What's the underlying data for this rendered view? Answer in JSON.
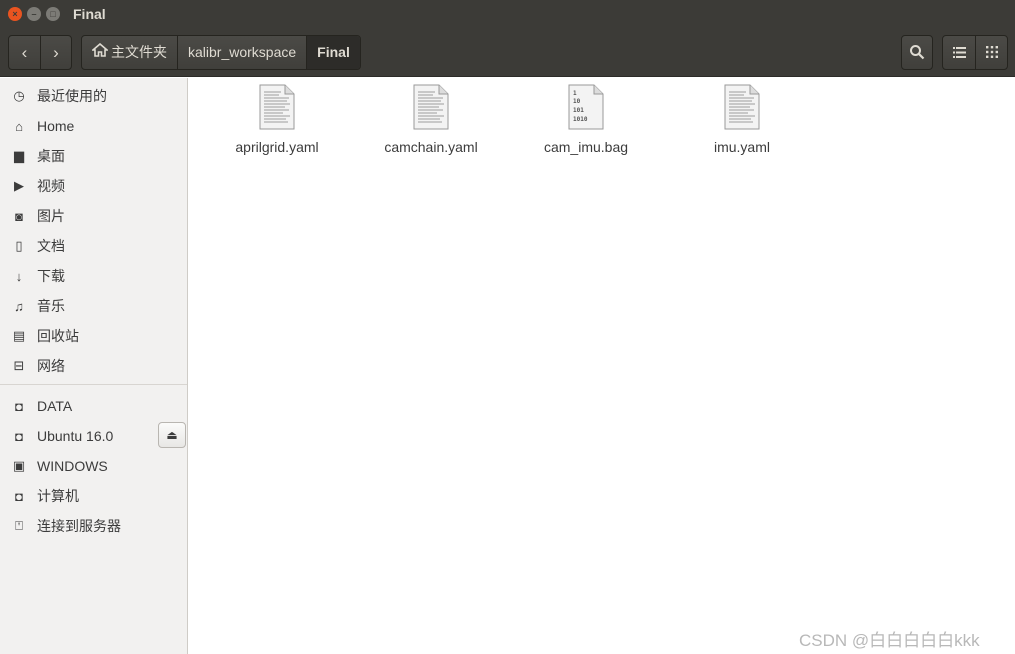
{
  "window": {
    "title": "Final",
    "close_glyph": "×",
    "min_glyph": "–",
    "max_glyph": "□"
  },
  "toolbar": {
    "back_glyph": "‹",
    "forward_glyph": "›",
    "breadcrumbs": [
      "主文件夹",
      "kalibr_workspace",
      "Final"
    ],
    "search_icon": "search-icon",
    "list_view_icon": "list-view-icon",
    "grid_view_icon": "grid-view-icon"
  },
  "sidebar": {
    "places": [
      {
        "label": "最近使用的",
        "icon": "clock-icon",
        "glyph": "◷"
      },
      {
        "label": "Home",
        "icon": "home-icon",
        "glyph": "⌂"
      },
      {
        "label": "桌面",
        "icon": "folder-icon",
        "glyph": "▆"
      },
      {
        "label": "视频",
        "icon": "video-icon",
        "glyph": "▶"
      },
      {
        "label": "图片",
        "icon": "camera-icon",
        "glyph": "◙"
      },
      {
        "label": "文档",
        "icon": "document-icon",
        "glyph": "▯"
      },
      {
        "label": "下载",
        "icon": "download-icon",
        "glyph": "↓"
      },
      {
        "label": "音乐",
        "icon": "music-icon",
        "glyph": "♫"
      },
      {
        "label": "回收站",
        "icon": "trash-icon",
        "glyph": "▤"
      },
      {
        "label": "网络",
        "icon": "network-icon",
        "glyph": "⊟"
      }
    ],
    "devices": [
      {
        "label": "DATA",
        "icon": "drive-icon",
        "glyph": "◘"
      },
      {
        "label": "Ubuntu 16.0",
        "icon": "drive-icon",
        "glyph": "◘"
      },
      {
        "label": "WINDOWS",
        "icon": "chip-drive-icon",
        "glyph": "▣"
      },
      {
        "label": "计算机",
        "icon": "drive-icon",
        "glyph": "◘"
      },
      {
        "label": "连接到服务器",
        "icon": "server-icon",
        "glyph": "⍞"
      }
    ],
    "eject_glyph": "⏏"
  },
  "files": [
    {
      "name": "aprilgrid.yaml",
      "icon": "text-file-icon"
    },
    {
      "name": "camchain.yaml",
      "icon": "text-file-icon"
    },
    {
      "name": "cam_imu.bag",
      "icon": "binary-file-icon",
      "binary_lines": [
        "1",
        "10",
        "101",
        "1010"
      ]
    },
    {
      "name": "imu.yaml",
      "icon": "text-file-icon"
    }
  ],
  "watermark": "CSDN @白白白白白kkk",
  "colors": {
    "titlebar": "#3c3b37",
    "accent_close": "#e95420",
    "sidebar_bg": "#f2f1f0",
    "content_bg": "#ffffff"
  }
}
